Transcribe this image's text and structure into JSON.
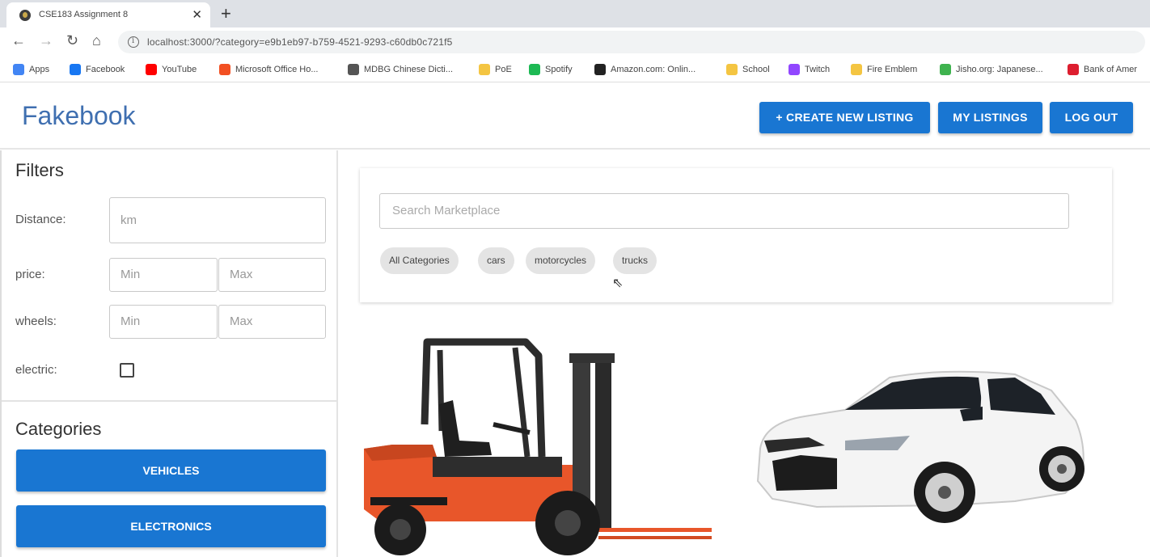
{
  "browser": {
    "tab_title": "CSE183 Assignment 8",
    "tab_close": "✕",
    "new_tab": "+",
    "url": "localhost:3000/?category=e9b1eb97-b759-4521-9293-c60db0c721f5",
    "bookmarks": [
      {
        "label": "Apps",
        "icon_color": "#4285f4"
      },
      {
        "label": "Facebook",
        "icon_color": "#1877f2"
      },
      {
        "label": "YouTube",
        "icon_color": "#ff0000"
      },
      {
        "label": "Microsoft Office Ho...",
        "icon_color": "#f25022"
      },
      {
        "label": "MDBG Chinese Dicti...",
        "icon_color": "#555555"
      },
      {
        "label": "PoE",
        "icon_color": "#f4c542"
      },
      {
        "label": "Spotify",
        "icon_color": "#1db954"
      },
      {
        "label": "Amazon.com: Onlin...",
        "icon_color": "#222222"
      },
      {
        "label": "School",
        "icon_color": "#f4c542"
      },
      {
        "label": "Twitch",
        "icon_color": "#9146ff"
      },
      {
        "label": "Fire Emblem",
        "icon_color": "#f4c542"
      },
      {
        "label": "Jisho.org: Japanese...",
        "icon_color": "#3fb34f"
      },
      {
        "label": "Bank of Amer",
        "icon_color": "#dd1e2f"
      }
    ]
  },
  "header": {
    "brand": "Fakebook",
    "create_listing": "+ CREATE NEW LISTING",
    "my_listings": "MY LISTINGS",
    "log_out": "LOG OUT",
    "accent_color": "#1976d2"
  },
  "filters": {
    "title": "Filters",
    "distance_label": "Distance:",
    "distance_placeholder": "km",
    "price_label": "price:",
    "price_min_placeholder": "Min",
    "price_max_placeholder": "Max",
    "wheels_label": "wheels:",
    "wheels_min_placeholder": "Min",
    "wheels_max_placeholder": "Max",
    "electric_label": "electric:"
  },
  "categories": {
    "title": "Categories",
    "items": [
      "VEHICLES",
      "ELECTRONICS"
    ]
  },
  "search": {
    "placeholder": "Search Marketplace",
    "chips": [
      "All Categories",
      "cars",
      "motorcycles",
      "trucks"
    ]
  },
  "listings": [
    {
      "image": "forklift-image"
    },
    {
      "image": "car-image"
    }
  ]
}
